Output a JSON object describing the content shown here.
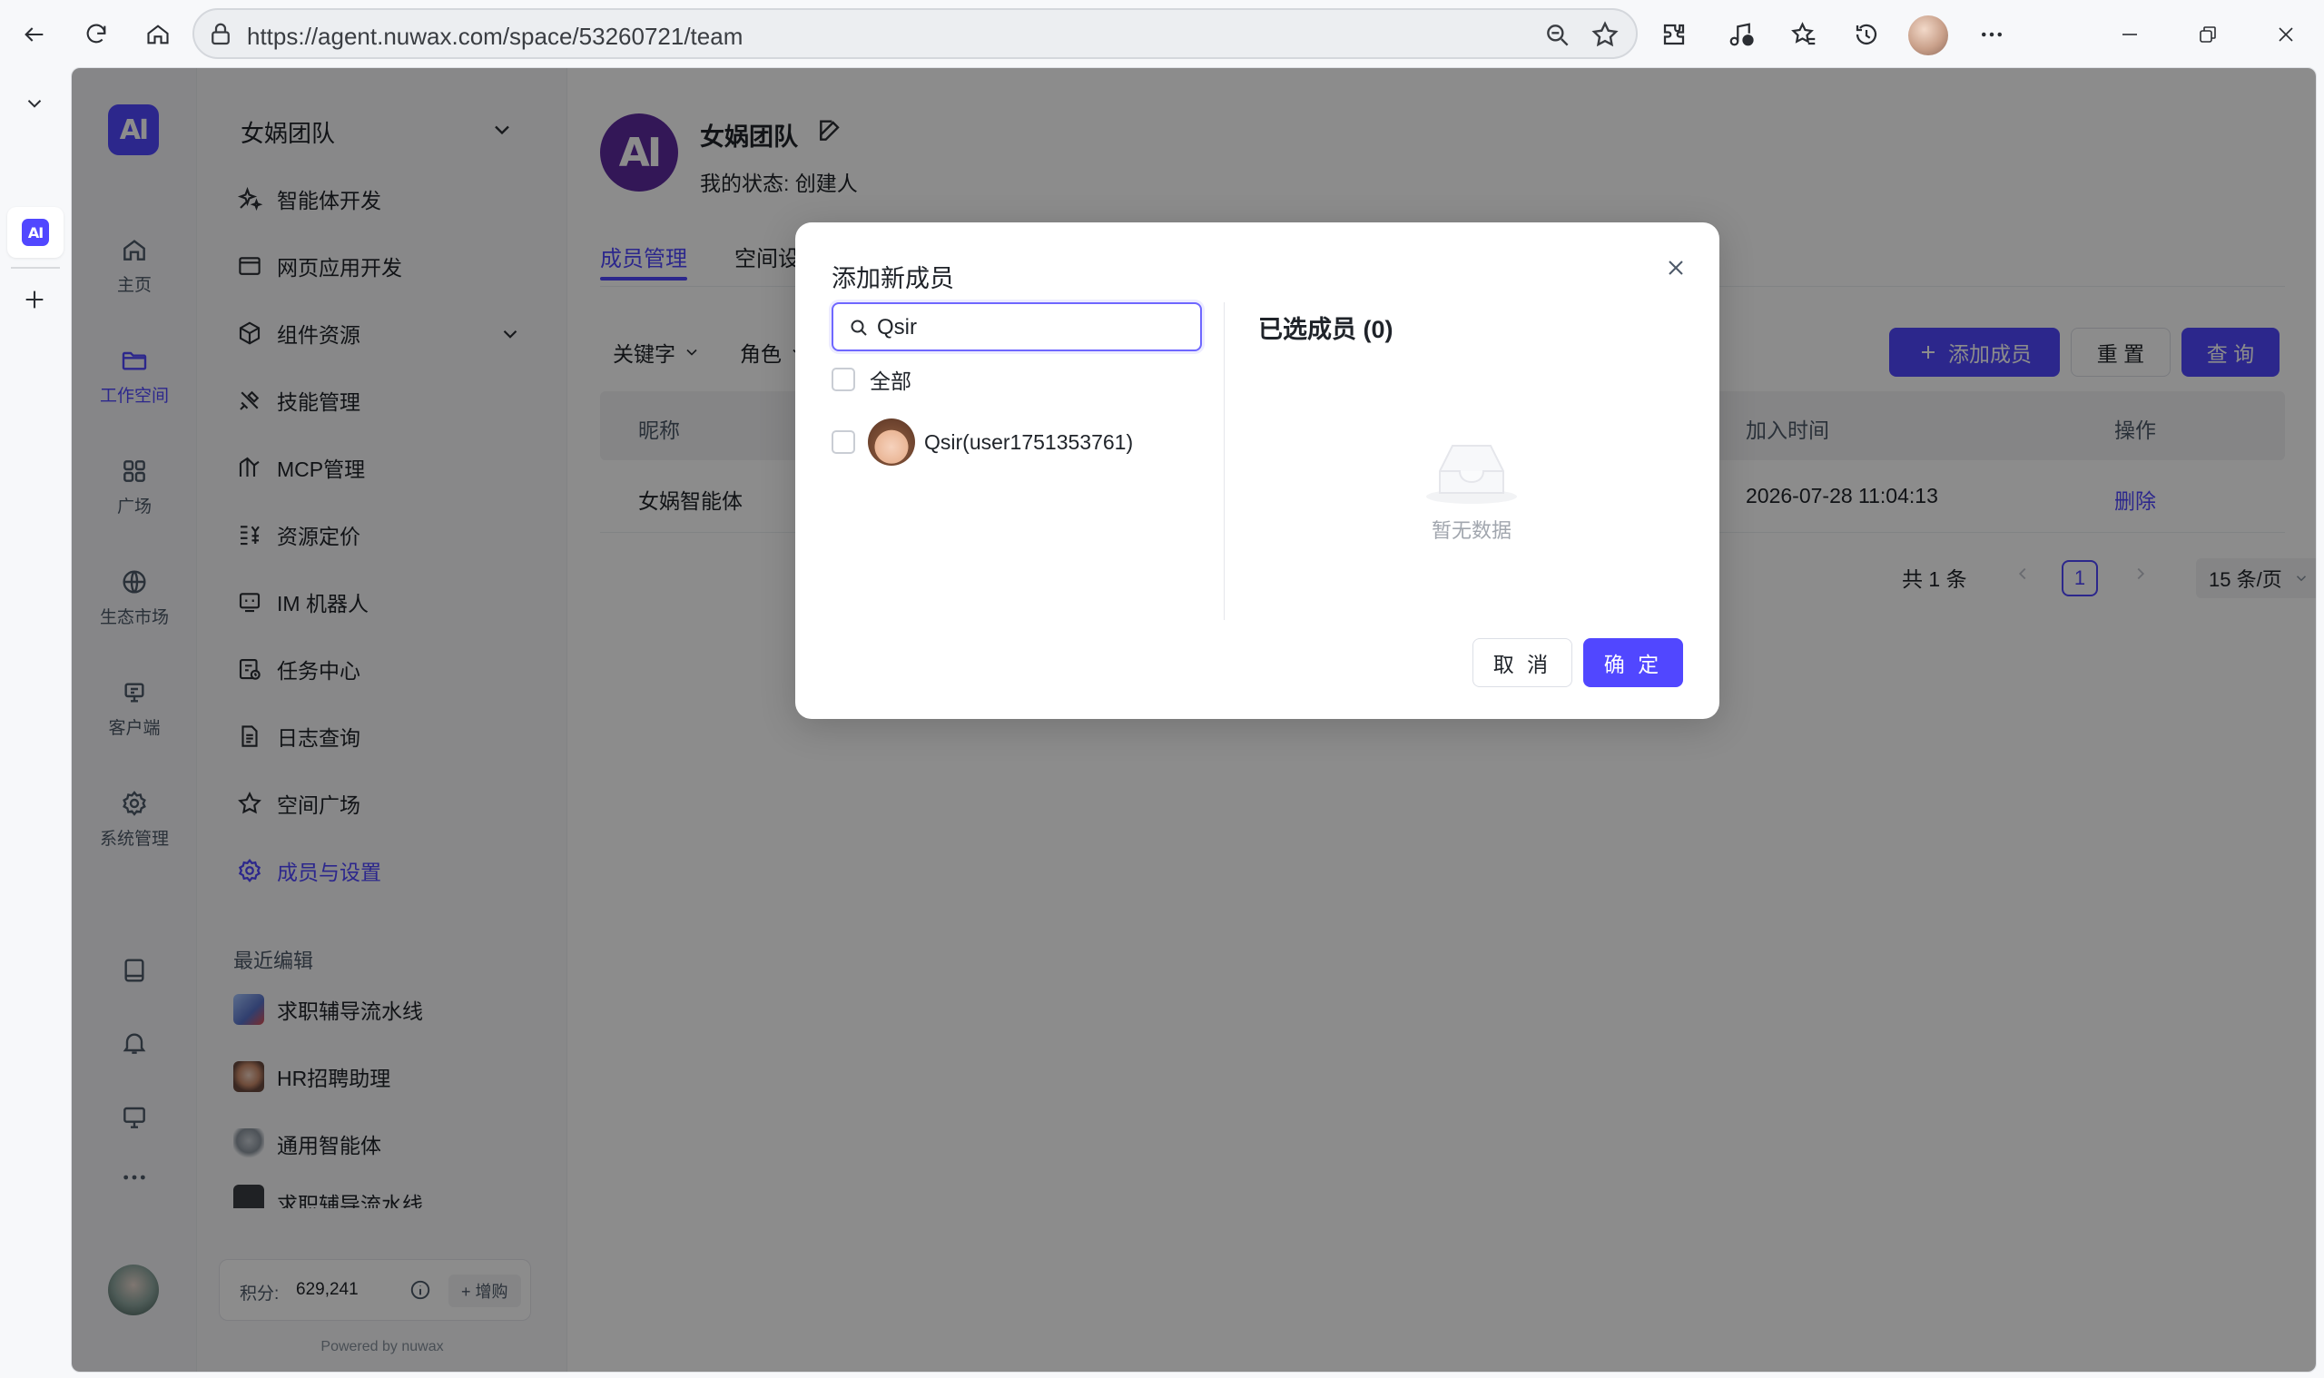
{
  "browser": {
    "url": "https://agent.nuwax.com/space/53260721/team"
  },
  "nav1": {
    "logo_text": "AI",
    "items": [
      {
        "label": "主页",
        "icon": "home-icon"
      },
      {
        "label": "工作空间",
        "icon": "folder-icon"
      },
      {
        "label": "广场",
        "icon": "grid-icon"
      },
      {
        "label": "生态市场",
        "icon": "globe-icon"
      },
      {
        "label": "客户端",
        "icon": "client-icon"
      },
      {
        "label": "系统管理",
        "icon": "gear-icon"
      }
    ]
  },
  "nav2": {
    "team_title": "女娲团队",
    "items": [
      {
        "label": "智能体开发",
        "icon": "sparkle-icon"
      },
      {
        "label": "网页应用开发",
        "icon": "browser-window-icon"
      },
      {
        "label": "组件资源",
        "icon": "cube-icon"
      },
      {
        "label": "技能管理",
        "icon": "tools-icon"
      },
      {
        "label": "MCP管理",
        "icon": "mcp-icon"
      },
      {
        "label": "资源定价",
        "icon": "pricing-icon"
      },
      {
        "label": "IM 机器人",
        "icon": "robot-icon"
      },
      {
        "label": "任务中心",
        "icon": "task-icon"
      },
      {
        "label": "日志查询",
        "icon": "log-icon"
      },
      {
        "label": "空间广场",
        "icon": "star-icon"
      },
      {
        "label": "成员与设置",
        "icon": "gear-icon"
      }
    ],
    "recent_label": "最近编辑",
    "recent": [
      {
        "label": "求职辅导流水线"
      },
      {
        "label": "HR招聘助理"
      },
      {
        "label": "通用智能体"
      },
      {
        "label": "求职辅导流水线"
      }
    ],
    "credits_label": "积分:",
    "credits_value": "629,241",
    "buy_label": "+ 增购",
    "powered": "Powered by nuwax"
  },
  "main": {
    "team_logo_text": "AI",
    "team_name": "女娲团队",
    "status": "我的状态: 创建人",
    "tabs": [
      "成员管理",
      "空间设"
    ],
    "filters": {
      "keyword": "关键字",
      "role": "角色"
    },
    "add_member": "添加成员",
    "reset": "重 置",
    "query": "查 询",
    "columns": {
      "nickname": "昵称",
      "join_time": "加入时间",
      "actions": "操作"
    },
    "rows": [
      {
        "nickname": "女娲智能体",
        "join_time": "2026-07-28 11:04:13",
        "action": "删除"
      }
    ],
    "pager": {
      "total": "共 1 条",
      "current": "1",
      "page_size": "15 条/页"
    }
  },
  "modal": {
    "title": "添加新成员",
    "search_value": "Qsir",
    "select_all": "全部",
    "candidates": [
      {
        "label": "Qsir(user1751353761)"
      }
    ],
    "selected_title": "已选成员 (0)",
    "empty_text": "暂无数据",
    "cancel": "取 消",
    "ok": "确 定"
  },
  "colors": {
    "accent": "#5147ff",
    "overlay": "rgba(0,0,0,0.45)"
  }
}
